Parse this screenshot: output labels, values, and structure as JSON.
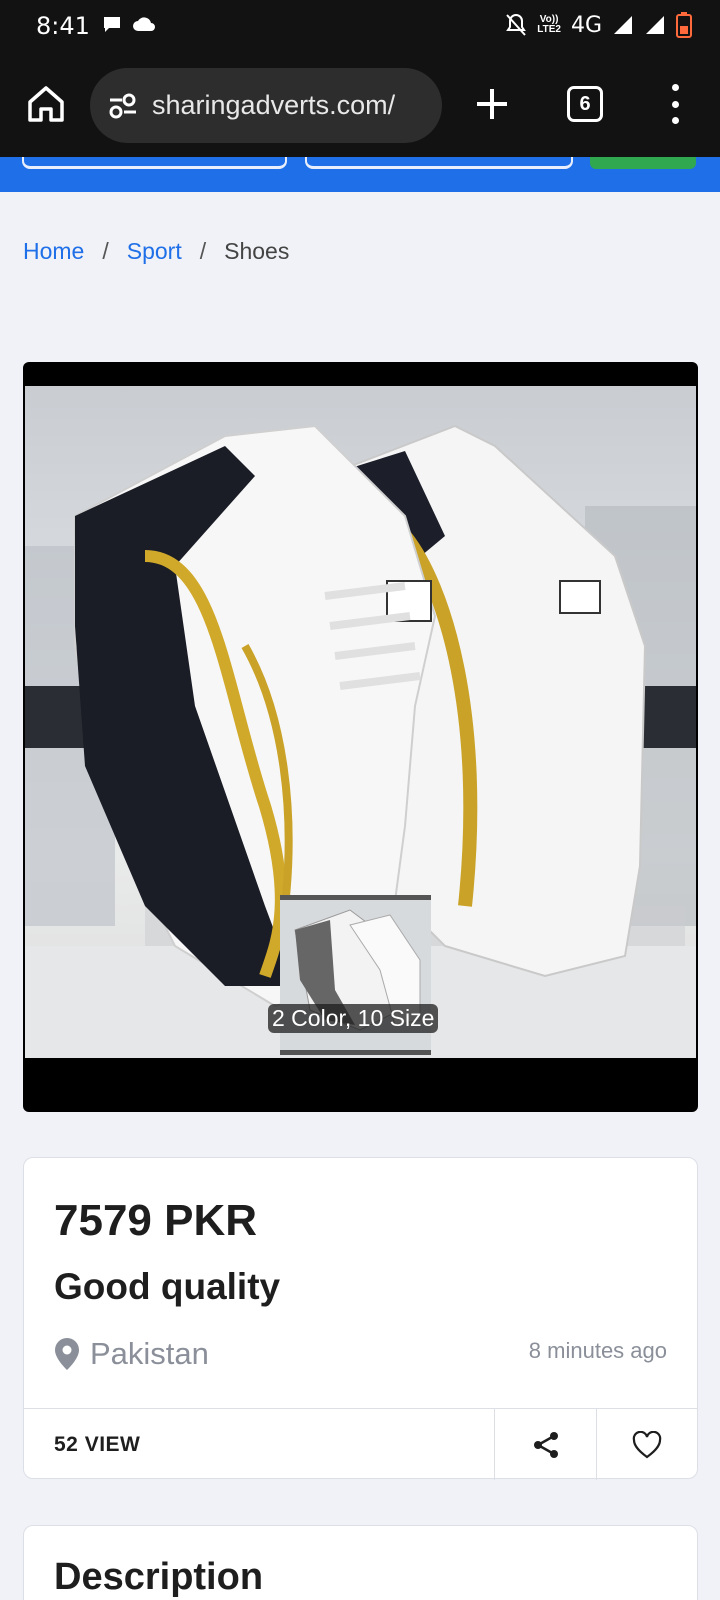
{
  "status_bar": {
    "time": "8:41",
    "network": "4G",
    "volte_line1": "Vo))",
    "volte_line2": "LTE2"
  },
  "browser": {
    "url": "sharingadverts.com/",
    "tab_count": "6"
  },
  "breadcrumb": {
    "items": [
      "Home",
      "Sport",
      "Shoes"
    ],
    "separator": "/"
  },
  "product_image": {
    "overlay_label": "2 Color, 10 Size"
  },
  "listing": {
    "price": "7579 PKR",
    "title": "Good quality",
    "location": "Pakistan",
    "posted": "8 minutes ago",
    "views": "52 VIEW"
  },
  "description": {
    "heading": "Description"
  },
  "colors": {
    "accent": "#1f6fe8",
    "header_green": "#2fa84f",
    "browser_bg": "#121212"
  }
}
